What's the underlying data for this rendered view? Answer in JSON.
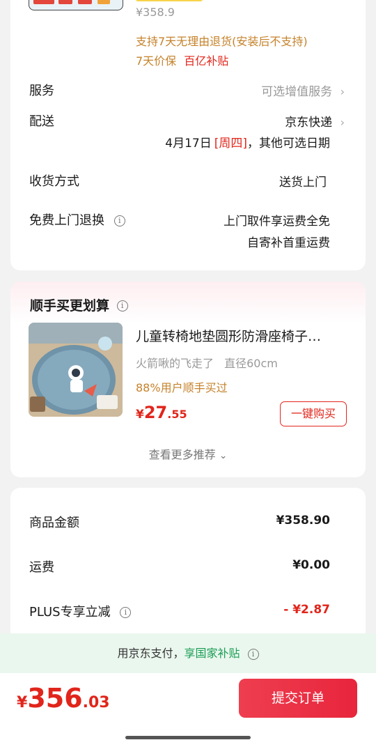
{
  "top_card": {
    "price": "¥358.9",
    "return_policy": "支持7天无理由退货(安装后不支持)",
    "price_protect": "7天价保",
    "subsidy": "百亿补贴"
  },
  "service": {
    "label": "服务",
    "value": "可选增值服务",
    "chevron": "›"
  },
  "delivery": {
    "label": "配送",
    "carrier": "京东快递",
    "chevron": "›",
    "date": "4月17日",
    "weekday": "[周四]",
    "note": "，其他可选日期"
  },
  "receive": {
    "label": "收货方式",
    "value": "送货上门"
  },
  "free_return": {
    "label": "免费上门退换",
    "line1": "上门取件享运费全免",
    "line2": "自寄补首重运费"
  },
  "recommend": {
    "title": "顺手买更划算",
    "product_name": "儿童转椅地垫圆形防滑座椅子…",
    "spec1": "火箭啾的飞走了",
    "spec2": "直径60cm",
    "bought": "88%用户顺手买过",
    "price_symbol": "¥",
    "price_int": "27",
    "price_dec": ".55",
    "buy_button": "一键购买",
    "more": "查看更多推荐",
    "more_chevron": "⌄"
  },
  "summary": {
    "goods_label": "商品金额",
    "goods_value": "¥358.90",
    "shipping_label": "运费",
    "shipping_value": "¥0.00",
    "plus_label": "PLUS专享立减",
    "plus_value": "- ¥2.87"
  },
  "banner": {
    "text1": "用京东支付，",
    "text2": "享国家补贴"
  },
  "footer": {
    "symbol": "¥",
    "total_int": "356",
    "total_dec": ".03",
    "submit": "提交订单"
  },
  "colors": {
    "red": "#e1251b",
    "orange": "#c5822b",
    "green": "#1a9d54",
    "banner_bg": "#eaf7ee"
  }
}
